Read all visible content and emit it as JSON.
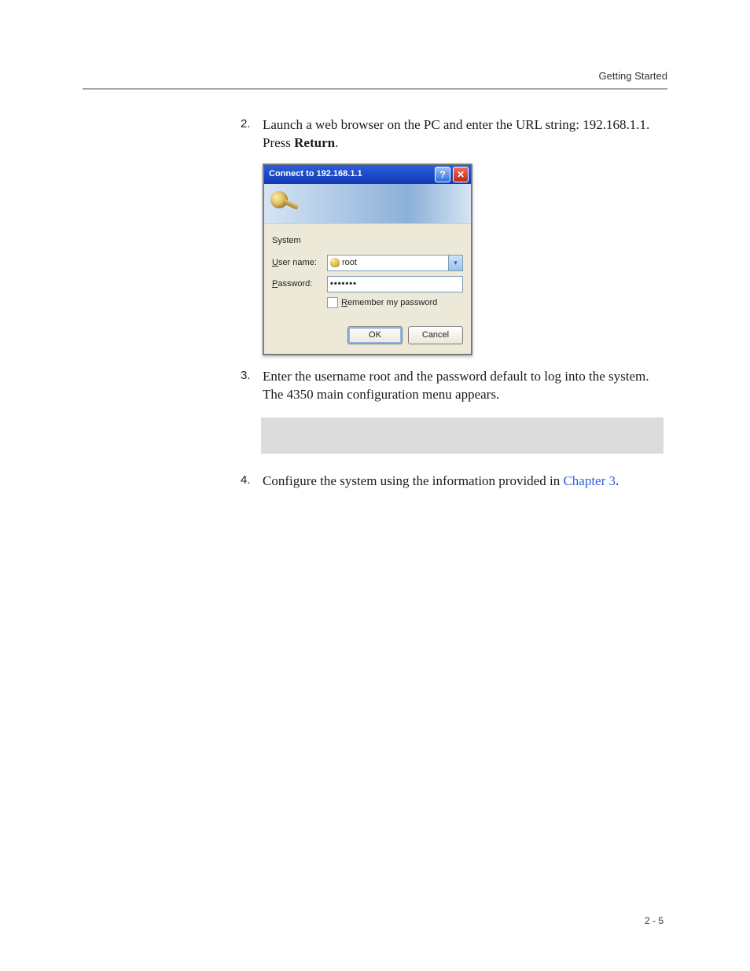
{
  "header": {
    "running": "Getting Started"
  },
  "steps": {
    "s2": {
      "num": "2.",
      "text_a": "Launch a web browser on the PC and enter the URL string: 192.168.1.1. Press ",
      "bold": "Return",
      "text_b": "."
    },
    "s3": {
      "num": "3.",
      "text": "Enter the username root and the password default to log into the system. The 4350 main configuration menu appears."
    },
    "s4": {
      "num": "4.",
      "text_a": "Configure the system using the information provided in ",
      "link": "Chapter 3",
      "text_b": "."
    }
  },
  "dialog": {
    "title": "Connect to 192.168.1.1",
    "help_glyph": "?",
    "close_glyph": "✕",
    "system_label": "System",
    "username_label_pre": "U",
    "username_label_post": "ser name:",
    "username_value": "root",
    "dropdown_glyph": "▾",
    "password_label_pre": "P",
    "password_label_post": "assword:",
    "password_dots": "•••••••",
    "remember_pre": "R",
    "remember_post": "emember my password",
    "ok": "OK",
    "cancel": "Cancel"
  },
  "footer": {
    "page": "2 - 5"
  }
}
